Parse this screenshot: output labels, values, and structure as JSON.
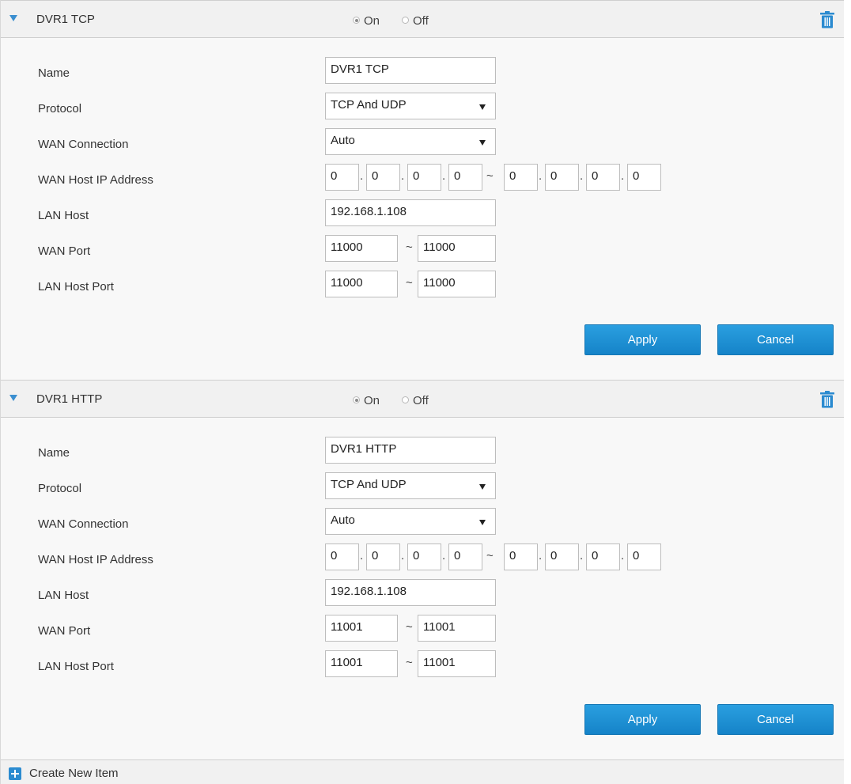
{
  "sections": [
    {
      "title": "DVR1 TCP",
      "on_label": "On",
      "off_label": "Off",
      "enabled": "On",
      "labels": {
        "name": "Name",
        "protocol": "Protocol",
        "wan_connection": "WAN Connection",
        "wan_host_ip": "WAN Host IP Address",
        "lan_host": "LAN Host",
        "wan_port": "WAN Port",
        "lan_host_port": "LAN Host Port"
      },
      "name_value": "DVR1 TCP",
      "protocol_value": "TCP And UDP",
      "wan_connection_value": "Auto",
      "ip_start": [
        "0",
        "0",
        "0",
        "0"
      ],
      "ip_end": [
        "0",
        "0",
        "0",
        "0"
      ],
      "ip_dot": ".",
      "range_sep": "~",
      "lan_host_value": "192.168.1.108",
      "wan_port_start": "11000",
      "wan_port_end": "11000",
      "lan_port_start": "11000",
      "lan_port_end": "11000",
      "apply_label": "Apply",
      "cancel_label": "Cancel"
    },
    {
      "title": "DVR1 HTTP",
      "on_label": "On",
      "off_label": "Off",
      "enabled": "On",
      "labels": {
        "name": "Name",
        "protocol": "Protocol",
        "wan_connection": "WAN Connection",
        "wan_host_ip": "WAN Host IP Address",
        "lan_host": "LAN Host",
        "wan_port": "WAN Port",
        "lan_host_port": "LAN Host Port"
      },
      "name_value": "DVR1 HTTP",
      "protocol_value": "TCP And UDP",
      "wan_connection_value": "Auto",
      "ip_start": [
        "0",
        "0",
        "0",
        "0"
      ],
      "ip_end": [
        "0",
        "0",
        "0",
        "0"
      ],
      "ip_dot": ".",
      "range_sep": "~",
      "lan_host_value": "192.168.1.108",
      "wan_port_start": "11001",
      "wan_port_end": "11001",
      "lan_port_start": "11001",
      "lan_port_end": "11001",
      "apply_label": "Apply",
      "cancel_label": "Cancel"
    }
  ],
  "footer": {
    "create_label": "Create New Item",
    "create_icon": "plus-icon"
  },
  "icons": {
    "collapse": "triangle-down-icon",
    "delete": "trash-icon",
    "select": "caret-down-icon"
  },
  "colors": {
    "accent": "#1a8fd6",
    "header_bg": "#f1f1f1",
    "panel_bg": "#f8f8f8"
  }
}
